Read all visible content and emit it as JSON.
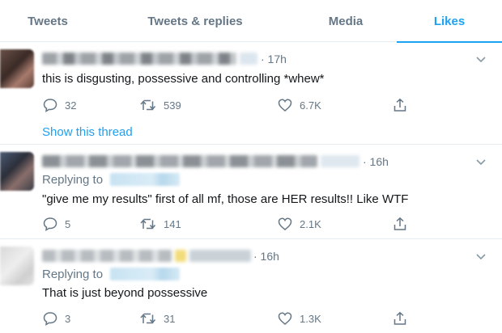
{
  "tabs": [
    {
      "label": "Tweets",
      "active": false
    },
    {
      "label": "Tweets & replies",
      "active": false
    },
    {
      "label": "Media",
      "active": false
    },
    {
      "label": "Likes",
      "active": true
    }
  ],
  "colors": {
    "accent": "#1da1f2",
    "secondary_text": "#657786",
    "border": "#e6ecf0"
  },
  "tweets": [
    {
      "time": "· 17h",
      "text": "this is disgusting, possessive and controlling *whew*",
      "replying_label": "",
      "counts": {
        "replies": "32",
        "retweets": "539",
        "likes": "6.7K"
      },
      "show_thread": "Show this thread"
    },
    {
      "time": "· 16h",
      "replying_label": "Replying to",
      "text": "\"give me my results\" first of all mf, those are HER results!! Like WTF",
      "counts": {
        "replies": "5",
        "retweets": "141",
        "likes": "2.1K"
      }
    },
    {
      "time": "· 16h",
      "replying_label": "Replying to",
      "text": "That is just beyond possessive",
      "counts": {
        "replies": "3",
        "retweets": "31",
        "likes": "1.3K"
      }
    }
  ],
  "icons": {
    "reply": "speech-bubble-icon",
    "retweet": "retweet-arrows-icon",
    "like": "heart-outline-icon",
    "share": "share-upload-icon",
    "caret": "chevron-down-icon"
  }
}
